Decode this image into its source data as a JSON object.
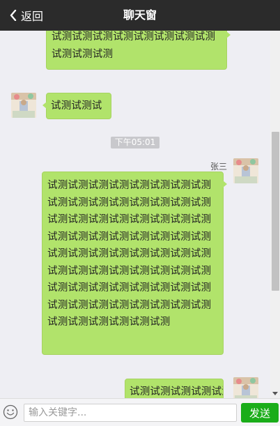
{
  "header": {
    "back_label": "返回",
    "title": "聊天窗"
  },
  "messages": [
    {
      "side": "right",
      "sender": "",
      "text": "试测试测试测试测试测试测试测试测试测试测试测"
    },
    {
      "side": "left",
      "sender": "",
      "text": "试测试测试"
    },
    {
      "side": "right",
      "sender": "张三",
      "text": "试测试测试测试测试测试测试测试测试测试测试测试测试测试测试测试测试测试测试测试测试测试测试测试测试测试测试测试测试测试测试测试测试测试测试测试测试测试测试测试测试测试测试测试测试测试测试测试测试测试测试测试测试测试测试测试测试测试测试测试测试测试测试测试测试测试测试测试测试测试测"
    },
    {
      "side": "right",
      "sender": "",
      "text": "试测试测试测试测试测"
    }
  ],
  "time_badge": "下午05:01",
  "input": {
    "placeholder": "输入关键字..."
  },
  "send_label": "发送",
  "colors": {
    "header_bg": "#2b2b2b",
    "bubble": "#b1e36b",
    "send_button": "#1aad19",
    "chat_bg": "#eeeef3"
  }
}
